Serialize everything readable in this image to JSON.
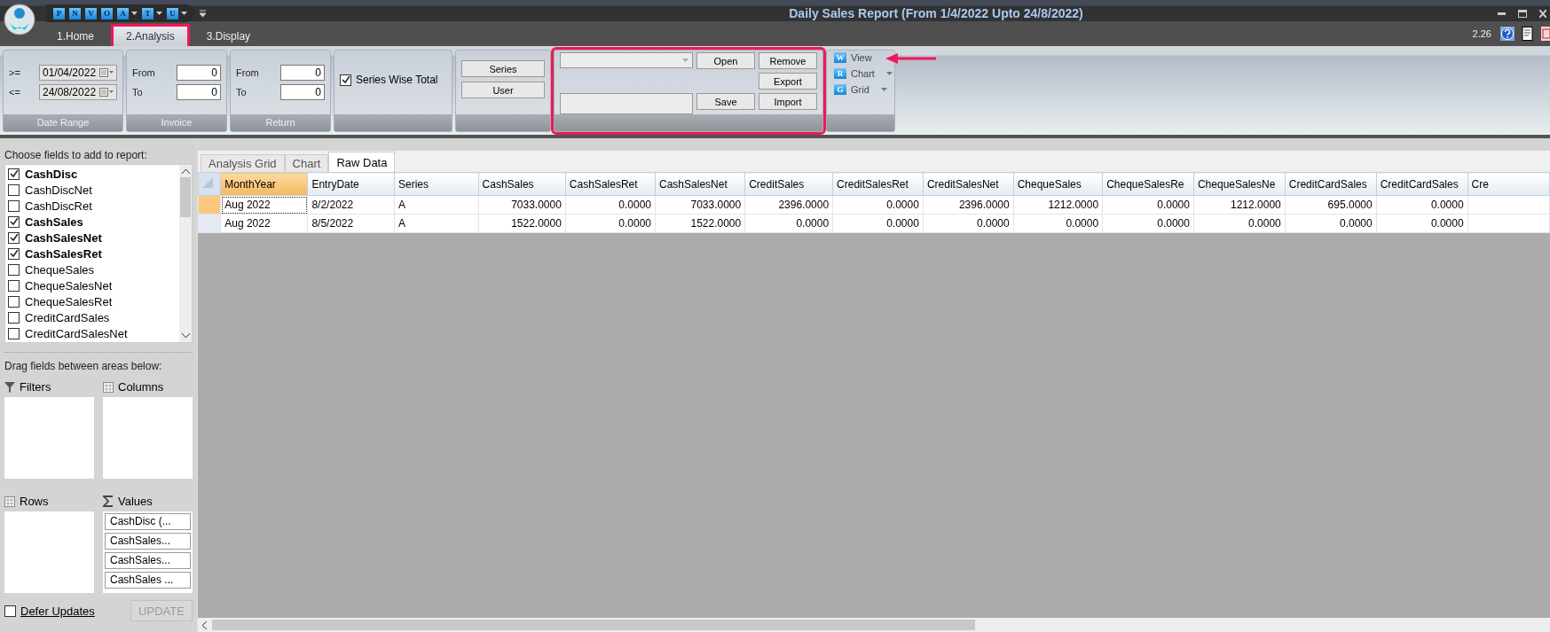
{
  "quick_access": [
    {
      "letter": "P",
      "has_menu": false
    },
    {
      "letter": "N",
      "has_menu": false
    },
    {
      "letter": "V",
      "has_menu": false
    },
    {
      "letter": "O",
      "has_menu": false
    },
    {
      "letter": "A",
      "has_menu": true
    },
    {
      "letter": "T",
      "has_menu": true
    },
    {
      "letter": "U",
      "has_menu": true
    }
  ],
  "window": {
    "title": "Daily Sales Report (From 1/4/2022 Upto 24/8/2022)"
  },
  "version": "2.26",
  "tabs": [
    {
      "label": "1.Home",
      "selected": false,
      "highlighted": false
    },
    {
      "label": "2.Analysis",
      "selected": true,
      "highlighted": true
    },
    {
      "label": "3.Display",
      "selected": false,
      "highlighted": false
    }
  ],
  "date_range": {
    "label": "Date Range",
    "rows": [
      {
        "op": ">=",
        "value": "01/04/2022"
      },
      {
        "op": "<=",
        "value": "24/08/2022"
      }
    ]
  },
  "invoice": {
    "label": "Invoice",
    "rows": [
      {
        "op": "From",
        "value": "0"
      },
      {
        "op": "To",
        "value": "0"
      }
    ]
  },
  "return": {
    "label": "Return",
    "rows": [
      {
        "op": "From",
        "value": "0"
      },
      {
        "op": "To",
        "value": "0"
      }
    ]
  },
  "series_wise_total": {
    "label": "Series Wise Total",
    "checked": true
  },
  "filter_buttons": [
    "Series",
    "User"
  ],
  "layout_group": {
    "highlighted": true,
    "open": "Open",
    "remove": "Remove",
    "export": "Export",
    "save": "Save",
    "import": "Import"
  },
  "view_group": {
    "arrow": true,
    "items": [
      {
        "letter": "W",
        "label": "View",
        "has_menu": false
      },
      {
        "letter": "R",
        "label": "Chart",
        "has_menu": true
      },
      {
        "letter": "G",
        "label": "Grid",
        "has_menu": true
      }
    ]
  },
  "field_list": {
    "title": "Choose fields to add to report:",
    "items": [
      {
        "label": "CashDisc",
        "checked": true
      },
      {
        "label": "CashDiscNet",
        "checked": false
      },
      {
        "label": "CashDiscRet",
        "checked": false
      },
      {
        "label": "CashSales",
        "checked": true
      },
      {
        "label": "CashSalesNet",
        "checked": true
      },
      {
        "label": "CashSalesRet",
        "checked": true
      },
      {
        "label": "ChequeSales",
        "checked": false
      },
      {
        "label": "ChequeSalesNet",
        "checked": false
      },
      {
        "label": "ChequeSalesRet",
        "checked": false
      },
      {
        "label": "CreditCardSales",
        "checked": false
      },
      {
        "label": "CreditCardSalesNet",
        "checked": false
      }
    ]
  },
  "areas": {
    "title": "Drag fields between areas below:",
    "filters": "Filters",
    "columns": "Columns",
    "rows": "Rows",
    "values": "Values",
    "value_items": [
      "CashDisc (...",
      "CashSales...",
      "CashSales...",
      "CashSales ..."
    ]
  },
  "defer_updates": {
    "label": "Defer Updates",
    "checked": false
  },
  "update_button": {
    "label": "UPDATE",
    "disabled": true
  },
  "view_tabs": [
    {
      "label": "Analysis Grid",
      "selected": false
    },
    {
      "label": "Chart",
      "selected": false
    },
    {
      "label": "Raw Data",
      "selected": true
    }
  ],
  "table": {
    "columns": [
      {
        "label": "MonthYear",
        "selected": true
      },
      {
        "label": "EntryDate",
        "selected": false
      },
      {
        "label": "Series",
        "selected": false
      },
      {
        "label": "CashSales",
        "selected": false
      },
      {
        "label": "CashSalesRet",
        "selected": false
      },
      {
        "label": "CashSalesNet",
        "selected": false
      },
      {
        "label": "CreditSales",
        "selected": false
      },
      {
        "label": "CreditSalesRet",
        "selected": false
      },
      {
        "label": "CreditSalesNet",
        "selected": false
      },
      {
        "label": "ChequeSales",
        "selected": false
      },
      {
        "label": "ChequeSalesRe",
        "selected": false
      },
      {
        "label": "ChequeSalesNe",
        "selected": false
      },
      {
        "label": "CreditCardSales",
        "selected": false
      },
      {
        "label": "CreditCardSales",
        "selected": false
      },
      {
        "label": "Cre",
        "selected": false
      }
    ],
    "rows": [
      {
        "selected": true,
        "cells": [
          "Aug 2022",
          "8/2/2022",
          "A",
          "7033.0000",
          "0.0000",
          "7033.0000",
          "2396.0000",
          "0.0000",
          "2396.0000",
          "1212.0000",
          "0.0000",
          "1212.0000",
          "695.0000",
          "0.0000"
        ]
      },
      {
        "selected": false,
        "cells": [
          "Aug 2022",
          "8/5/2022",
          "A",
          "1522.0000",
          "0.0000",
          "1522.0000",
          "0.0000",
          "0.0000",
          "0.0000",
          "0.0000",
          "0.0000",
          "0.0000",
          "0.0000",
          "0.0000"
        ]
      }
    ]
  }
}
